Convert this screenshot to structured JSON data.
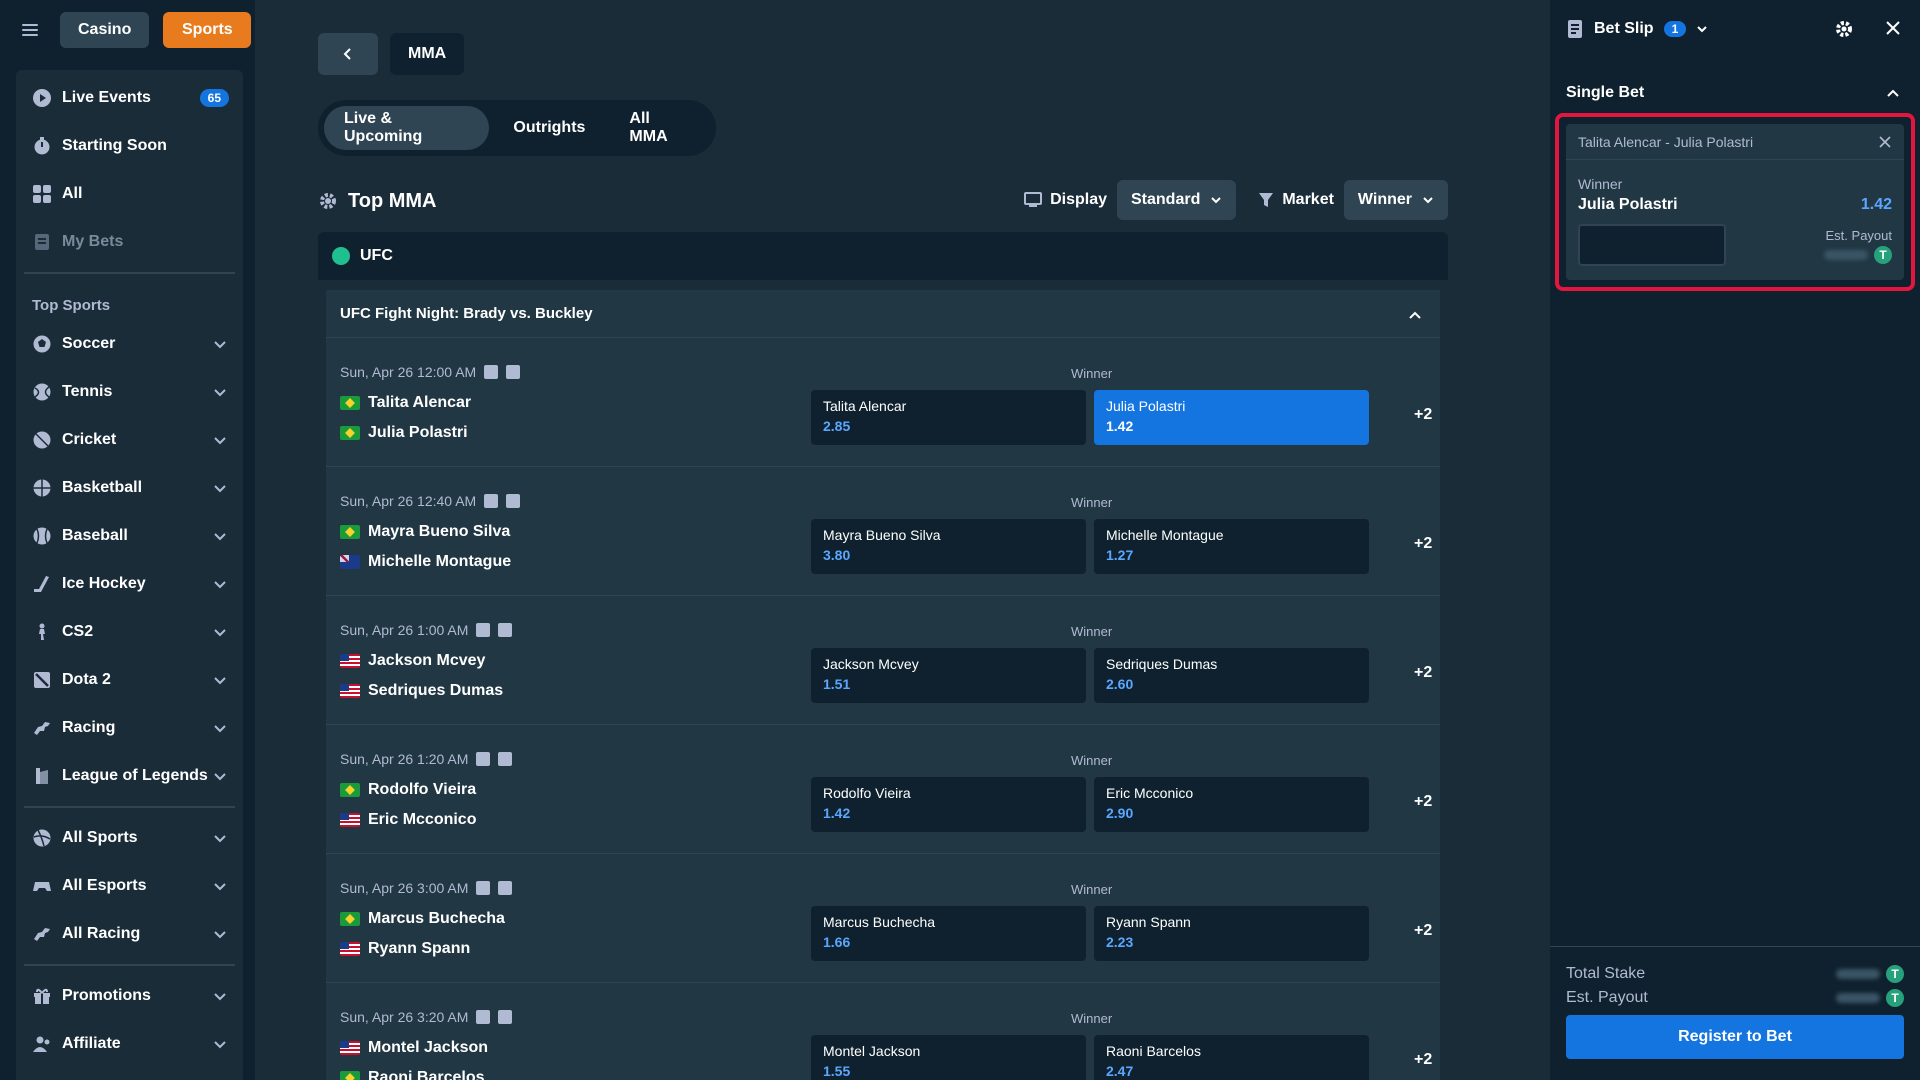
{
  "topbar": {
    "casino": "Casino",
    "sports": "Sports"
  },
  "sidebar": {
    "items": [
      {
        "label": "Live Events",
        "icon": "play-circle-icon",
        "badge": "65"
      },
      {
        "label": "Starting Soon",
        "icon": "stopwatch-icon"
      },
      {
        "label": "All",
        "icon": "grid-icon"
      },
      {
        "label": "My Bets",
        "icon": "receipt-icon"
      }
    ],
    "top_sports_title": "Top Sports",
    "sports": [
      {
        "label": "Soccer",
        "icon": "soccer-ball-icon"
      },
      {
        "label": "Tennis",
        "icon": "tennis-ball-icon"
      },
      {
        "label": "Cricket",
        "icon": "cricket-ball-icon"
      },
      {
        "label": "Basketball",
        "icon": "basketball-icon"
      },
      {
        "label": "Baseball",
        "icon": "baseball-icon"
      },
      {
        "label": "Ice Hockey",
        "icon": "hockey-stick-icon"
      },
      {
        "label": "CS2",
        "icon": "soldier-icon"
      },
      {
        "label": "Dota 2",
        "icon": "dota-icon"
      },
      {
        "label": "Racing",
        "icon": "horse-icon"
      },
      {
        "label": "League of Legends",
        "icon": "lol-icon"
      }
    ],
    "all_items": [
      {
        "label": "All Sports",
        "icon": "sports-ball-icon"
      },
      {
        "label": "All Esports",
        "icon": "gamepad-icon"
      },
      {
        "label": "All Racing",
        "icon": "horse-icon"
      }
    ],
    "footer_items": [
      {
        "label": "Promotions",
        "icon": "gift-icon"
      },
      {
        "label": "Affiliate",
        "icon": "affiliate-icon"
      }
    ]
  },
  "main": {
    "breadcrumb": "MMA",
    "tabs": [
      "Live & Upcoming",
      "Outrights",
      "All MMA"
    ],
    "heading": "Top MMA",
    "display_label": "Display",
    "display_value": "Standard",
    "market_label": "Market",
    "market_value": "Winner",
    "league": "UFC",
    "event": "UFC Fight Night: Brady vs. Buckley",
    "matches": [
      {
        "time": "Sun, Apr 26  12:00 AM",
        "market": "Winner",
        "team1": "Talita Alencar",
        "flag1": "br",
        "team2": "Julia Polastri",
        "flag2": "br",
        "odds1": "2.85",
        "odds2": "1.42",
        "more": "+2",
        "selected": 2
      },
      {
        "time": "Sun, Apr 26  12:40 AM",
        "market": "Winner",
        "team1": "Mayra Bueno Silva",
        "flag1": "br",
        "team2": "Michelle Montague",
        "flag2": "au",
        "odds1": "3.80",
        "odds2": "1.27",
        "more": "+2",
        "selected": 0
      },
      {
        "time": "Sun, Apr 26  1:00 AM",
        "market": "Winner",
        "team1": "Jackson Mcvey",
        "flag1": "us",
        "team2": "Sedriques Dumas",
        "flag2": "us",
        "odds1": "1.51",
        "odds2": "2.60",
        "more": "+2",
        "selected": 0
      },
      {
        "time": "Sun, Apr 26  1:20 AM",
        "market": "Winner",
        "team1": "Rodolfo Vieira",
        "flag1": "br",
        "team2": "Eric Mcconico",
        "flag2": "us",
        "odds1": "1.42",
        "odds2": "2.90",
        "more": "+2",
        "selected": 0
      },
      {
        "time": "Sun, Apr 26  3:00 AM",
        "market": "Winner",
        "team1": "Marcus Buchecha",
        "flag1": "br",
        "team2": "Ryann Spann",
        "flag2": "us",
        "odds1": "1.66",
        "odds2": "2.23",
        "more": "+2",
        "selected": 0
      },
      {
        "time": "Sun, Apr 26  3:20 AM",
        "market": "Winner",
        "team1": "Montel Jackson",
        "flag1": "us",
        "team2": "Raoni Barcelos",
        "flag2": "br",
        "odds1": "1.55",
        "odds2": "2.47",
        "more": "+2",
        "selected": 0
      }
    ]
  },
  "betslip": {
    "title": "Bet Slip",
    "count": "1",
    "section": "Single Bet",
    "card_title": "Talita Alencar - Julia Polastri",
    "market": "Winner",
    "pick": "Julia Polastri",
    "odds": "1.42",
    "est_payout_label": "Est. Payout",
    "total_stake_label": "Total Stake",
    "est_payout_footer_label": "Est. Payout",
    "register_label": "Register to Bet",
    "currency_symbol": "T"
  },
  "colors": {
    "background": "#1a2c38",
    "sidebar": "#0f212e",
    "accent_blue": "#1475e1",
    "sports_orange": "#e87b1e",
    "highlight_red": "#e2163f"
  }
}
